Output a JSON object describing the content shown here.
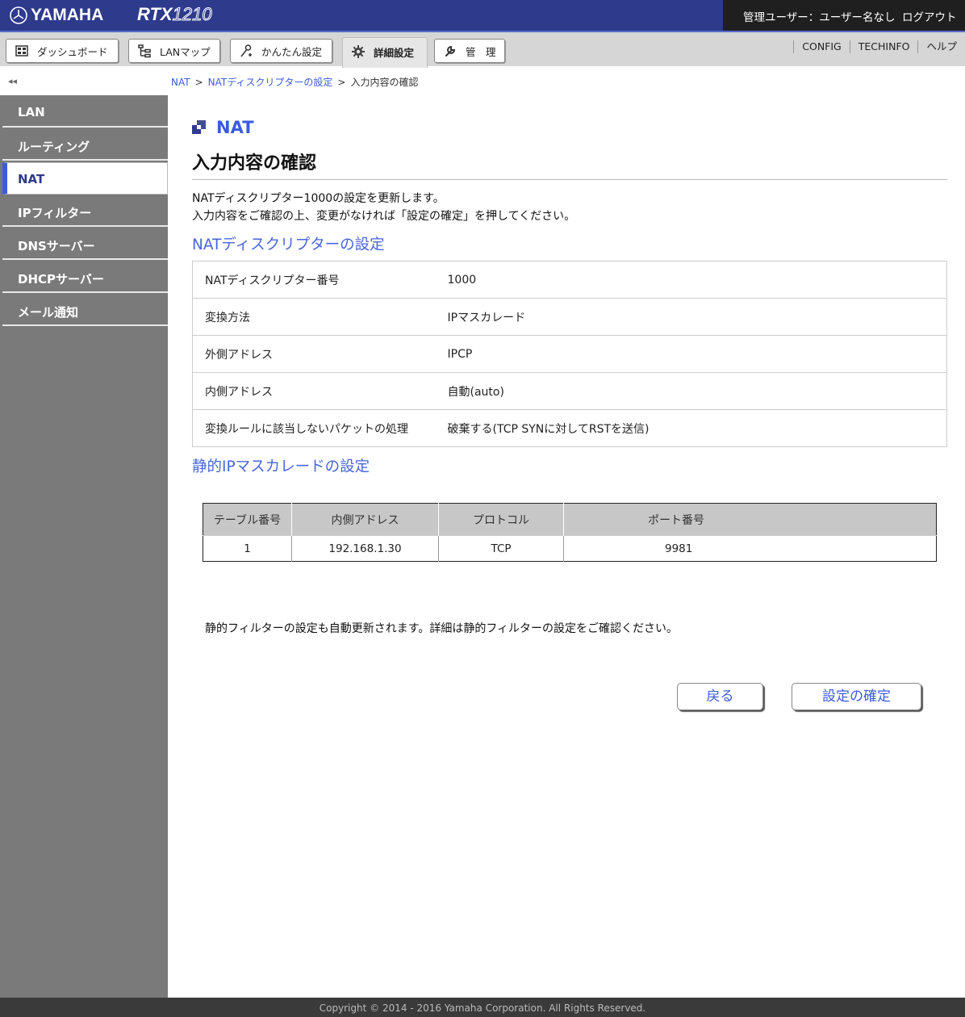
{
  "header": {
    "brand": "YAMAHA",
    "model_prefix": "RTX",
    "model_number": "1210",
    "user_label": "管理ユーザー：ユーザー名なし",
    "logout_label": "ログアウト"
  },
  "tabs": [
    {
      "label": "ダッシュボード",
      "icon": "dashboard-icon"
    },
    {
      "label": "LANマップ",
      "icon": "lan-map-icon"
    },
    {
      "label": "かんたん設定",
      "icon": "wand-icon"
    },
    {
      "label": "詳細設定",
      "icon": "gear-icon",
      "active": true
    },
    {
      "label": "管　理",
      "icon": "wrench-icon"
    }
  ],
  "top_links": {
    "config": "CONFIG",
    "techinfo": "TECHINFO",
    "help": "ヘルプ"
  },
  "sidebar": {
    "collapse_symbol": "◂◂",
    "items": [
      {
        "label": "LAN"
      },
      {
        "label": "ルーティング"
      },
      {
        "label": "NAT",
        "active": true
      },
      {
        "label": "IPフィルター"
      },
      {
        "label": "DNSサーバー"
      },
      {
        "label": "DHCPサーバー"
      },
      {
        "label": "メール通知"
      }
    ]
  },
  "breadcrumb": {
    "items": [
      "NAT",
      "NATディスクリプターの設定",
      "入力内容の確認"
    ],
    "separator": ">"
  },
  "main": {
    "section_title": "NAT",
    "page_title": "入力内容の確認",
    "intro_line1": "NATディスクリプター1000の設定を更新します。",
    "intro_line2": "入力内容をご確認の上、変更がなければ「設定の確定」を押してください。",
    "nat_heading": "NATディスクリプターの設定",
    "nat_rows": [
      {
        "key": "NATディスクリプター番号",
        "value": "1000"
      },
      {
        "key": "変換方法",
        "value": "IPマスカレード"
      },
      {
        "key": "外側アドレス",
        "value": "IPCP"
      },
      {
        "key": "内側アドレス",
        "value": "自動(auto)"
      },
      {
        "key": "変換ルールに該当しないパケットの処理",
        "value": "破棄する(TCP SYNに対してRSTを送信)"
      }
    ],
    "masq_heading": "静的IPマスカレードの設定",
    "masq_columns": [
      "テーブル番号",
      "内側アドレス",
      "プロトコル",
      "ポート番号"
    ],
    "masq_rows": [
      {
        "table_no": "1",
        "inner_address": "192.168.1.30",
        "protocol": "TCP",
        "port": "9981"
      }
    ],
    "note": "静的フィルターの設定も自動更新されます。詳細は静的フィルターの設定をご確認ください。",
    "back_label": "戻る",
    "confirm_label": "設定の確定"
  },
  "footer": {
    "copyright": "Copyright © 2014 - 2016 Yamaha Corporation. All Rights Reserved."
  },
  "colors": {
    "brand_blue": "#2e3a8c",
    "accent_blue": "#3b5bdb",
    "sidebar_gray": "#7a7a7a"
  }
}
